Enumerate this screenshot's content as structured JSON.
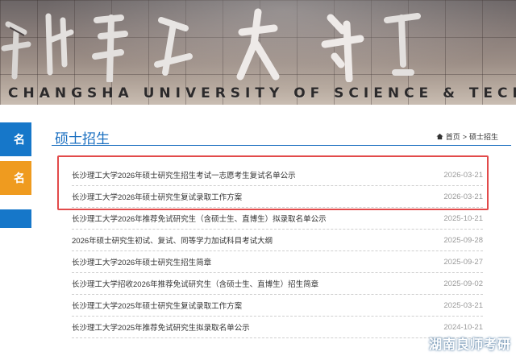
{
  "banner": {
    "english_name": "CHANGSHA UNIVERSITY OF SCIENCE & TECHNOLOGY"
  },
  "sidebar": {
    "items": [
      {
        "label": "名",
        "color": "#1677c9"
      },
      {
        "label": "名",
        "color": "#ef9b1f"
      }
    ]
  },
  "header": {
    "section_title": "硕士招生",
    "breadcrumb": {
      "icon": "home-icon",
      "home": "首页",
      "separator": ">",
      "current": "硕士招生"
    }
  },
  "news": [
    {
      "title": "长沙理工大学2026年硕士研究生招生考试一志愿考生复试名单公示",
      "date": "2026-03-21"
    },
    {
      "title": "长沙理工大学2026年硕士研究生复试录取工作方案",
      "date": "2026-03-21"
    },
    {
      "title": "长沙理工大学2026年推荐免试研究生（含硕士生、直博生）拟录取名单公示",
      "date": "2025-10-21"
    },
    {
      "title": "2026年硕士研究生初试、复试、同等学力加试科目考试大纲",
      "date": "2025-09-28"
    },
    {
      "title": "长沙理工大学2026年硕士研究生招生简章",
      "date": "2025-09-27"
    },
    {
      "title": "长沙理工大学招收2026年推荐免试研究生（含硕士生、直博生）招生简章",
      "date": "2025-09-02"
    },
    {
      "title": "长沙理工大学2025年硕士研究生复试录取工作方案",
      "date": "2025-03-21"
    },
    {
      "title": "长沙理工大学2025年推荐免试研究生拟录取名单公示",
      "date": "2024-10-21"
    }
  ],
  "watermark": "湖南良师考研",
  "colors": {
    "accent_blue": "#1a6fc0",
    "highlight_red": "#e24a4a",
    "sidebar_orange": "#ef9b1f"
  }
}
